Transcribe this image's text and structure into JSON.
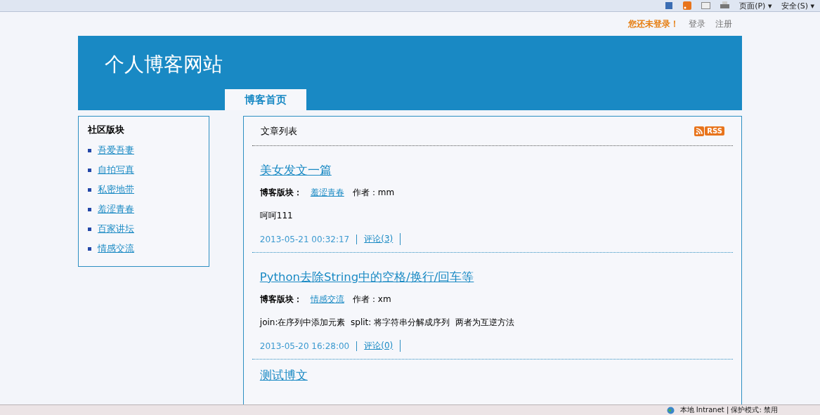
{
  "browser_toolbar": {
    "menus": [
      {
        "label": "页面(P) ▾"
      },
      {
        "label": "安全(S) ▾"
      }
    ]
  },
  "user_bar": {
    "status": "您还未登录！",
    "links": [
      "登录",
      "注册"
    ]
  },
  "header": {
    "site_title": "个人博客网站",
    "tabs": [
      {
        "label": "博客首页",
        "selected": true
      }
    ]
  },
  "sidebar": {
    "title": "社区版块",
    "items": [
      "吾爱吾妻",
      "自拍写真",
      "私密地带",
      "羞涩青春",
      "百家讲坛",
      "情感交流"
    ]
  },
  "article_list": {
    "title": "文章列表",
    "rss_label": "RSS",
    "posts": [
      {
        "title": "美女发文一篇",
        "section_label": "博客版块：",
        "section": "羞涩青春",
        "author": "作者：mm",
        "excerpt": "呵呵111",
        "date": "2013-05-21 00:32:17",
        "comments": "评论(3)"
      },
      {
        "title": "Python去除String中的空格/换行/回车等",
        "section_label": "博客版块：",
        "section": "情感交流",
        "author": "作者：xm",
        "excerpt": "join:在序列中添加元素  split: 将字符串分解成序列  两者为互逆方法",
        "date": "2013-05-20 16:28:00",
        "comments": "评论(0)"
      },
      {
        "title": "测试博文"
      }
    ]
  },
  "status_bar": {
    "zone": "本地 Intranet | 保护模式: 禁用"
  }
}
